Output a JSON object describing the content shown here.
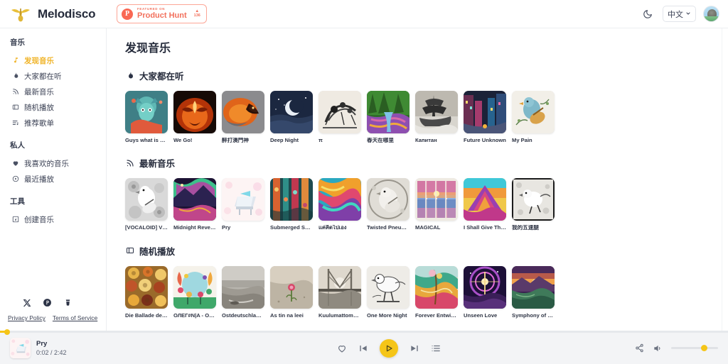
{
  "header": {
    "brand_name": "Melodisco",
    "brand_logo_icon": "winged-guitar-logo",
    "product_hunt": {
      "featured_label": "FEATURED ON",
      "name": "Product Hunt",
      "upvote_caret": "▲",
      "upvote_count": "136",
      "logo_letter": "P"
    },
    "theme_toggle_icon": "moon-icon",
    "language": {
      "label": "中文",
      "chevron": "∨"
    },
    "avatar_icon": "user-avatar"
  },
  "sidebar": {
    "groups": [
      {
        "title": "音乐",
        "items": [
          {
            "label": "发现音乐",
            "icon": "music-note-icon",
            "active": true
          },
          {
            "label": "大家都在听",
            "icon": "flame-icon",
            "active": false
          },
          {
            "label": "最新音乐",
            "icon": "rss-icon",
            "active": false
          },
          {
            "label": "随机播放",
            "icon": "shuffle-box-icon",
            "active": false
          },
          {
            "label": "推荐歌单",
            "icon": "playlist-icon",
            "active": false
          }
        ]
      },
      {
        "title": "私人",
        "items": [
          {
            "label": "我喜欢的音乐",
            "icon": "heart-filled-icon",
            "active": false
          },
          {
            "label": "最近播放",
            "icon": "clock-play-icon",
            "active": false
          }
        ]
      },
      {
        "title": "工具",
        "items": [
          {
            "label": "创建音乐",
            "icon": "create-music-icon",
            "active": false
          }
        ]
      }
    ],
    "socials": [
      {
        "name": "x-twitter-icon",
        "glyph": "𝕏"
      },
      {
        "name": "product-hunt-icon",
        "glyph": "P"
      },
      {
        "name": "buymeacoffee-icon",
        "glyph": "☕"
      }
    ],
    "legal": [
      {
        "label": "Privacy Policy"
      },
      {
        "label": "Terms of Service"
      }
    ]
  },
  "main": {
    "page_title": "发现音乐",
    "sections": [
      {
        "title": "大家都在听",
        "icon": "flame-icon",
        "cards": [
          {
            "title": "Guys what is wro...",
            "art": "cat"
          },
          {
            "title": "We Go!",
            "art": "phoenix"
          },
          {
            "title": "醉打澳門神",
            "art": "dragon"
          },
          {
            "title": "Deep Night",
            "art": "moon"
          },
          {
            "title": "π",
            "art": "inkcity"
          },
          {
            "title": "春天在哪里",
            "art": "forest"
          },
          {
            "title": "Капитан",
            "art": "ship"
          },
          {
            "title": "Future Unknown",
            "art": "neoncity"
          },
          {
            "title": "My Pain",
            "art": "birdguitar"
          }
        ]
      },
      {
        "title": "最新音乐",
        "icon": "rss-icon",
        "cards": [
          {
            "title": "[VOCALOID] Virt...",
            "art": "monobird"
          },
          {
            "title": "Midnight Reverie",
            "art": "aurora"
          },
          {
            "title": "Pry",
            "art": "piano"
          },
          {
            "title": "Submerged Sere...",
            "art": "abstractcol"
          },
          {
            "title": "แค่คิดไปเอง",
            "art": "swirl"
          },
          {
            "title": "Twisted Pneumat...",
            "art": "sketchbird"
          },
          {
            "title": "MAGICAL",
            "art": "panels"
          },
          {
            "title": "I Shall Give Than...",
            "art": "mountain"
          },
          {
            "title": "我的五速腿",
            "art": "monobird2"
          }
        ]
      },
      {
        "title": "随机播放",
        "icon": "shuffle-box-icon",
        "cards": [
          {
            "title": "Die Ballade der N...",
            "art": "bowls"
          },
          {
            "title": "ОЛЕГ#N|A - One...",
            "art": "folkart"
          },
          {
            "title": "Ostdeutschland, ...",
            "art": "beach"
          },
          {
            "title": "As tin na leei",
            "art": "rose"
          },
          {
            "title": "Kuulumattomat S...",
            "art": "bridge"
          },
          {
            "title": "One More Night",
            "art": "sketchbird2"
          },
          {
            "title": "Forever Entwined",
            "art": "valley"
          },
          {
            "title": "Unseen Love",
            "art": "cosmic"
          },
          {
            "title": "Symphony of Life",
            "art": "sunset"
          }
        ]
      }
    ]
  },
  "player": {
    "progress_percent": 1,
    "now_playing": {
      "title": "Pry",
      "time": "0:02 / 2:42",
      "art": "piano"
    },
    "controls": [
      {
        "name": "like-button",
        "icon": "heart-outline-icon"
      },
      {
        "name": "previous-button",
        "icon": "previous-track-icon"
      },
      {
        "name": "play-button",
        "icon": "play-icon"
      },
      {
        "name": "next-button",
        "icon": "next-track-icon"
      },
      {
        "name": "queue-button",
        "icon": "queue-list-icon"
      }
    ],
    "share_icon": "share-icon",
    "volume_icon": "volume-icon",
    "volume_percent": 70
  },
  "colors": {
    "accent": "#f5c518",
    "active_nav": "#f0b429",
    "product_hunt": "#f2705c",
    "player_bg": "#f3f4f6"
  }
}
